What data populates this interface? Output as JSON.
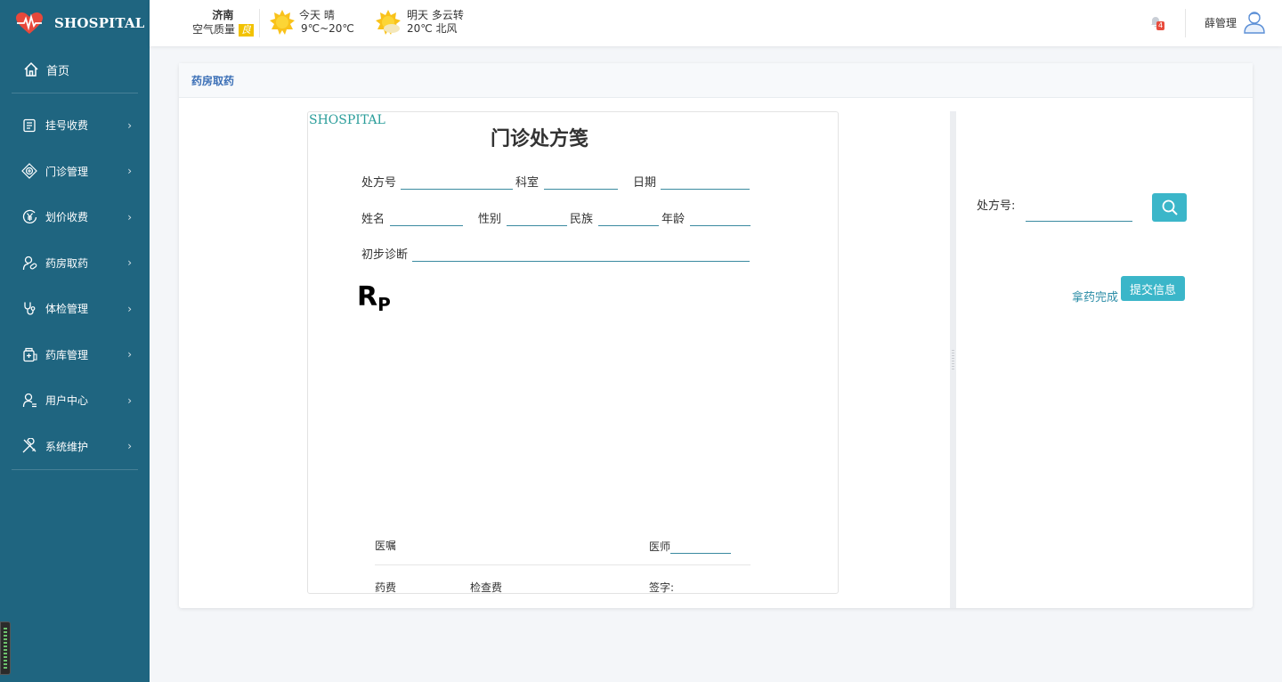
{
  "brand": {
    "name": "SHOSPITAL"
  },
  "sidebar": {
    "home": "首页",
    "items": [
      {
        "label": "挂号收费",
        "icon": "register-icon"
      },
      {
        "label": "门诊管理",
        "icon": "clinic-icon"
      },
      {
        "label": "划价收费",
        "icon": "yuan-icon"
      },
      {
        "label": "药房取药",
        "icon": "pharmacy-icon"
      },
      {
        "label": "体检管理",
        "icon": "stethoscope-icon"
      },
      {
        "label": "药库管理",
        "icon": "medicine-box-icon"
      },
      {
        "label": "用户中心",
        "icon": "user-icon"
      },
      {
        "label": "系统维护",
        "icon": "tools-icon"
      }
    ]
  },
  "topbar": {
    "city": "济南",
    "air_quality_label": "空气质量",
    "air_quality_value": "良",
    "today": {
      "day": "今天",
      "desc": "晴",
      "temp": "9℃~20℃"
    },
    "tomorrow": {
      "day": "明天",
      "desc": "多云转",
      "temp": "20℃ 北风"
    },
    "notifications": "4",
    "user_name": "薛管理"
  },
  "page": {
    "title": "药房取药"
  },
  "prescription": {
    "watermark": "SHOSPITAL",
    "title": "门诊处方笺",
    "labels": {
      "no": "处方号",
      "dept": "科室",
      "date": "日期",
      "name": "姓名",
      "sex": "性别",
      "ethnic": "民族",
      "age": "年龄",
      "diagnosis": "初步诊断",
      "rp_main": "R",
      "rp_sub": "P",
      "advice": "医嘱",
      "doctor": "医师",
      "drug_fee": "药费",
      "exam_fee": "检查费",
      "signature": "签字:"
    }
  },
  "right_panel": {
    "no_label": "处方号:",
    "no_value": "",
    "done_label": "拿药完成",
    "submit_label": "提交信息"
  }
}
